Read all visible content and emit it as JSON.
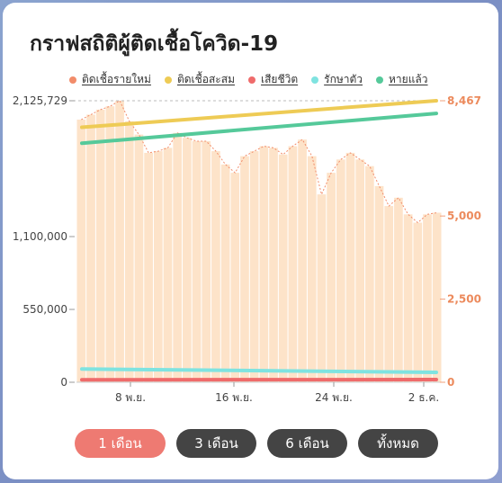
{
  "title": "กราฟสถิติผู้ติดเชื้อโควิด-19",
  "legend": [
    {
      "label": "ติดเชื้อรายใหม่",
      "color": "#f28c6a"
    },
    {
      "label": "ติดเชื้อสะสม",
      "color": "#eecb55"
    },
    {
      "label": "เสียชีวิต",
      "color": "#ef6b6b"
    },
    {
      "label": "รักษาตัว",
      "color": "#7fe3e0"
    },
    {
      "label": "หายแล้ว",
      "color": "#55c99a"
    }
  ],
  "buttons": [
    {
      "label": "1 เดือน",
      "active": true
    },
    {
      "label": "3 เดือน",
      "active": false
    },
    {
      "label": "6 เดือน",
      "active": false
    },
    {
      "label": "ทั้งหมด",
      "active": false
    }
  ],
  "chart_data": {
    "type": "bar",
    "x_tick_labels": [
      "8 พ.ย.",
      "16 พ.ย.",
      "24 พ.ย.",
      "2 ธ.ค."
    ],
    "left_axis": {
      "ticks": [
        "0",
        "550,000",
        "1,100,000",
        "2,125,729"
      ],
      "ylim": [
        0,
        2125729
      ]
    },
    "right_axis": {
      "ticks": [
        "0",
        "2,500",
        "5,000",
        "8,467"
      ],
      "ylim": [
        0,
        8467
      ]
    },
    "grid": false,
    "series": [
      {
        "name": "ติดเชื้อรายใหม่",
        "axis": "right",
        "type": "bar",
        "values": [
          7900,
          8050,
          8200,
          8300,
          8467,
          7850,
          7450,
          6900,
          6950,
          7050,
          7500,
          7350,
          7250,
          7250,
          6950,
          6550,
          6300,
          6800,
          6950,
          7100,
          7050,
          6850,
          7100,
          7300,
          6800,
          5650,
          6300,
          6700,
          6900,
          6700,
          6500,
          5900,
          5300,
          5550,
          5050,
          4800,
          5050,
          5100
        ]
      },
      {
        "name": "ติดเชื้อสะสม",
        "axis": "left",
        "type": "line",
        "values": [
          1925000,
          2125729
        ]
      },
      {
        "name": "เสียชีวิต",
        "axis": "left",
        "type": "line",
        "values": [
          19000,
          20000
        ]
      },
      {
        "name": "รักษาตัว",
        "axis": "left",
        "type": "line",
        "values": [
          100000,
          75000
        ]
      },
      {
        "name": "หายแล้ว",
        "axis": "left",
        "type": "line",
        "values": [
          1805000,
          2030000
        ]
      }
    ]
  }
}
